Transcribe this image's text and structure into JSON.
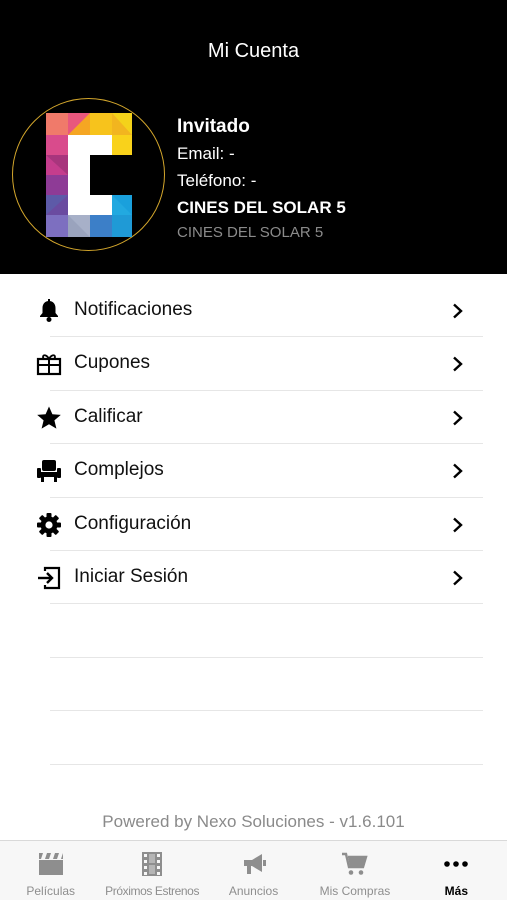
{
  "header": {
    "title": "Mi Cuenta",
    "avatar_ring_color": "#d3a62c"
  },
  "profile": {
    "name": "Invitado",
    "email": "Email: -",
    "phone": "Teléfono: -",
    "cinema": "CINES DEL SOLAR 5",
    "cinema_sub": "CINES DEL SOLAR 5"
  },
  "menu": {
    "items": [
      {
        "label": "Notificaciones",
        "icon": "bell-icon"
      },
      {
        "label": "Cupones",
        "icon": "gift-icon"
      },
      {
        "label": "Calificar",
        "icon": "star-icon"
      },
      {
        "label": "Complejos",
        "icon": "seat-icon"
      },
      {
        "label": "Configuración",
        "icon": "gear-icon"
      },
      {
        "label": "Iniciar Sesión",
        "icon": "sign-in-icon"
      }
    ]
  },
  "footer": {
    "powered_by": "Powered by Nexo Soluciones - v1.6.101"
  },
  "tabbar": {
    "active_color": "#000000",
    "inactive_color": "#8e8e8e",
    "tabs": [
      {
        "label": "Películas",
        "icon": "clapperboard-icon"
      },
      {
        "label": "Próximos Estrenos",
        "icon": "film-strip-icon"
      },
      {
        "label": "Anuncios",
        "icon": "megaphone-icon"
      },
      {
        "label": "Mis Compras",
        "icon": "cart-icon"
      },
      {
        "label": "Más",
        "icon": "more-icon",
        "active": true
      }
    ]
  }
}
